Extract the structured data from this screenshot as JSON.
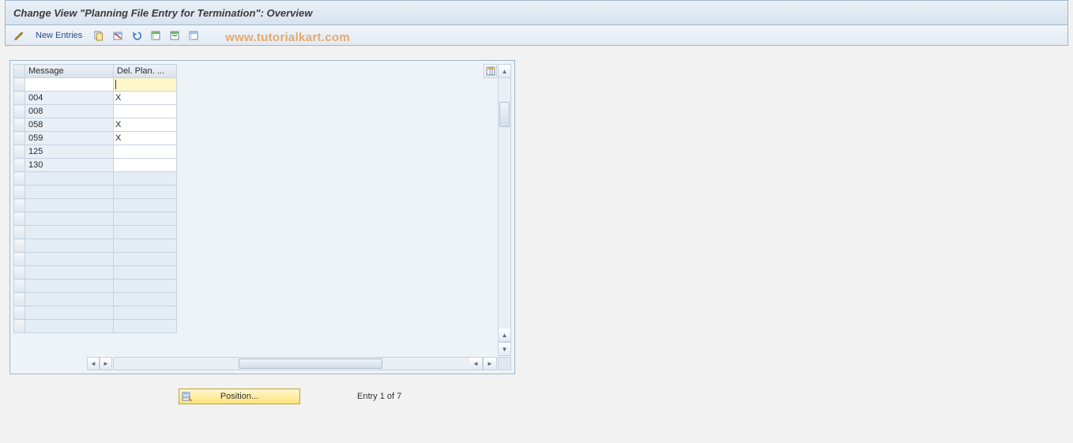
{
  "title": "Change View \"Planning File Entry for Termination\": Overview",
  "toolbar": {
    "new_entries_label": "New Entries"
  },
  "watermark": "www.tutorialkart.com",
  "grid": {
    "columns": {
      "message": "Message",
      "del_plan": "Del. Plan. ..."
    },
    "rows": [
      {
        "message": "",
        "del_plan": "",
        "insert": true
      },
      {
        "message": "004",
        "del_plan": "X"
      },
      {
        "message": "008",
        "del_plan": ""
      },
      {
        "message": "058",
        "del_plan": "X"
      },
      {
        "message": "059",
        "del_plan": "X"
      },
      {
        "message": "125",
        "del_plan": ""
      },
      {
        "message": "130",
        "del_plan": ""
      }
    ],
    "empty_rows": 12
  },
  "footer": {
    "position_label": "Position...",
    "entry_text": "Entry 1 of 7"
  }
}
